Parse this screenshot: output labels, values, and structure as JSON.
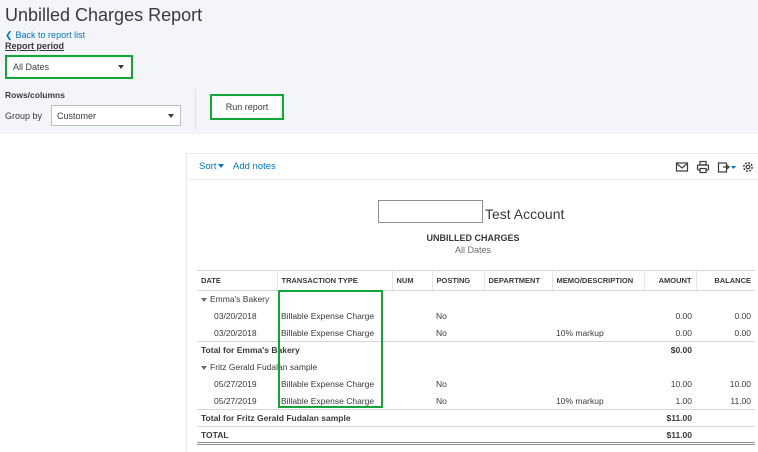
{
  "header": {
    "title": "Unbilled Charges Report",
    "back_label": "Back to report list"
  },
  "filters": {
    "report_period_label": "Report period",
    "report_period_value": "All Dates",
    "rows_columns_label": "Rows/columns",
    "group_by_label": "Group by",
    "group_by_value": "Customer",
    "run_report_label": "Run report"
  },
  "toolbar": {
    "sort_label": "Sort",
    "add_notes_label": "Add notes",
    "icons": [
      "email-icon",
      "print-icon",
      "export-icon",
      "settings-icon"
    ]
  },
  "report": {
    "company": "Test Account",
    "title": "UNBILLED CHARGES",
    "subtitle": "All Dates",
    "columns": [
      "DATE",
      "TRANSACTION TYPE",
      "NUM",
      "POSTING",
      "DEPARTMENT",
      "MEMO/DESCRIPTION",
      "AMOUNT",
      "BALANCE"
    ],
    "groups": [
      {
        "name": "Emma's Bakery",
        "rows": [
          {
            "date": "03/20/2018",
            "type": "Billable Expense Charge",
            "num": "",
            "posting": "No",
            "department": "",
            "memo": "",
            "amount": "0.00",
            "balance": "0.00"
          },
          {
            "date": "03/20/2018",
            "type": "Billable Expense Charge",
            "num": "",
            "posting": "No",
            "department": "",
            "memo": "10% markup",
            "amount": "0.00",
            "balance": "0.00"
          }
        ],
        "total_label": "Total for Emma's Bakery",
        "total_amount": "$0.00"
      },
      {
        "name": "Fritz Gerald Fudalan sample",
        "rows": [
          {
            "date": "05/27/2019",
            "type": "Billable Expense Charge",
            "num": "",
            "posting": "No",
            "department": "",
            "memo": "",
            "amount": "10.00",
            "balance": "10.00"
          },
          {
            "date": "05/27/2019",
            "type": "Billable Expense Charge",
            "num": "",
            "posting": "No",
            "department": "",
            "memo": "10% markup",
            "amount": "1.00",
            "balance": "11.00"
          }
        ],
        "total_label": "Total for Fritz Gerald Fudalan sample",
        "total_amount": "$11.00"
      }
    ],
    "grand_total_label": "TOTAL",
    "grand_total_amount": "$11.00"
  },
  "colors": {
    "highlight": "#13a538",
    "link": "#0077c5",
    "header_bg": "#f4f5f8"
  }
}
